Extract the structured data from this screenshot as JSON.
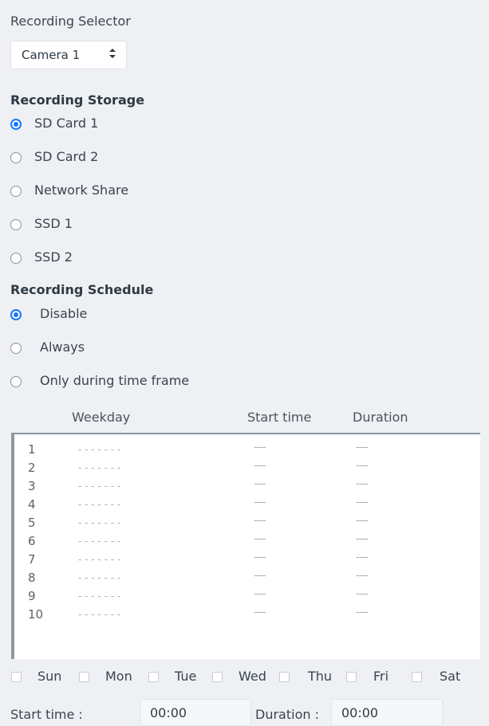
{
  "recording_selector": {
    "title": "Recording Selector",
    "selected": "Camera 1"
  },
  "recording_storage": {
    "title": "Recording Storage",
    "options": [
      {
        "label": "SD Card 1",
        "checked": true
      },
      {
        "label": "SD Card 2",
        "checked": false
      },
      {
        "label": "Network Share",
        "checked": false
      },
      {
        "label": "SSD 1",
        "checked": false
      },
      {
        "label": "SSD 2",
        "checked": false
      }
    ]
  },
  "recording_schedule": {
    "title": "Recording Schedule",
    "options": [
      {
        "label": "Disable",
        "checked": true
      },
      {
        "label": "Always",
        "checked": false
      },
      {
        "label": "Only during time frame",
        "checked": false
      }
    ]
  },
  "schedule_table": {
    "headers": {
      "weekday": "Weekday",
      "start_time": "Start time",
      "duration": "Duration"
    },
    "rows": [
      {
        "index": "1",
        "weekday": "- - - - - - -",
        "start": "----",
        "duration": "----"
      },
      {
        "index": "2",
        "weekday": "- - - - - - -",
        "start": "----",
        "duration": "----"
      },
      {
        "index": "3",
        "weekday": "- - - - - - -",
        "start": "----",
        "duration": "----"
      },
      {
        "index": "4",
        "weekday": "- - - - - - -",
        "start": "----",
        "duration": "----"
      },
      {
        "index": "5",
        "weekday": "- - - - - - -",
        "start": "----",
        "duration": "----"
      },
      {
        "index": "6",
        "weekday": "- - - - - - -",
        "start": "----",
        "duration": "----"
      },
      {
        "index": "7",
        "weekday": "- - - - - - -",
        "start": "----",
        "duration": "----"
      },
      {
        "index": "8",
        "weekday": "- - - - - - -",
        "start": "----",
        "duration": "----"
      },
      {
        "index": "9",
        "weekday": "- - - - - - -",
        "start": "----",
        "duration": "----"
      },
      {
        "index": "10",
        "weekday": "- - - - - - -",
        "start": "----",
        "duration": "----"
      }
    ]
  },
  "weekdays": [
    {
      "label": "Sun",
      "checked": false
    },
    {
      "label": "Mon",
      "checked": false
    },
    {
      "label": "Tue",
      "checked": false
    },
    {
      "label": "Wed",
      "checked": false
    },
    {
      "label": "Thu",
      "checked": false
    },
    {
      "label": "Fri",
      "checked": false
    },
    {
      "label": "Sat",
      "checked": false
    }
  ],
  "time_fields": {
    "start_label": "Start time :",
    "start_value": "00:00",
    "duration_label": "Duration :",
    "duration_value": "00:00"
  },
  "colors": {
    "accent": "#1677ff",
    "background": "#eef0f4"
  },
  "icons": {
    "select_arrow": "updown-chevron-icon"
  }
}
